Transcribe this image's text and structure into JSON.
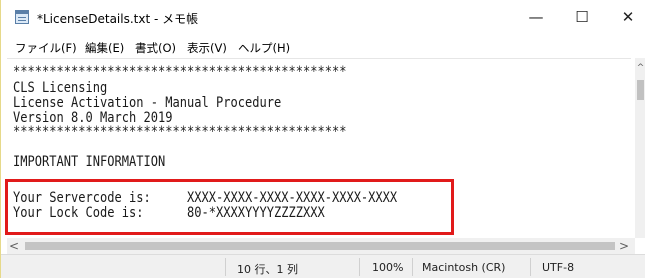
{
  "window": {
    "title": "*LicenseDetails.txt - メモ帳",
    "minimize_glyph": "—",
    "maximize_glyph": "☐",
    "close_glyph": "✕"
  },
  "menu": {
    "items": [
      {
        "label": "ファイル(F)"
      },
      {
        "label": "編集(E)"
      },
      {
        "label": "書式(O)"
      },
      {
        "label": "表示(V)"
      },
      {
        "label": "ヘルプ(H)"
      }
    ]
  },
  "document": {
    "lines": [
      "**********************************************",
      "CLS Licensing",
      "License Activation - Manual Procedure",
      "Version 8.0 March 2019",
      "**********************************************",
      "",
      "IMPORTANT INFORMATION",
      "",
      "Your Servercode is:     XXXX-XXXX-XXXX-XXXX-XXXX-XXXX",
      "Your Lock Code is:      80-*XXXXYYYYZZZZXXX"
    ]
  },
  "highlight": {
    "color": "#e11a1a"
  },
  "scrollbars": {
    "up_glyph": "^",
    "left_glyph": "<",
    "right_glyph": ">"
  },
  "status": {
    "position": "10 行、1 列",
    "zoom": "100%",
    "line_ending": "Macintosh (CR)",
    "encoding": "UTF-8"
  }
}
